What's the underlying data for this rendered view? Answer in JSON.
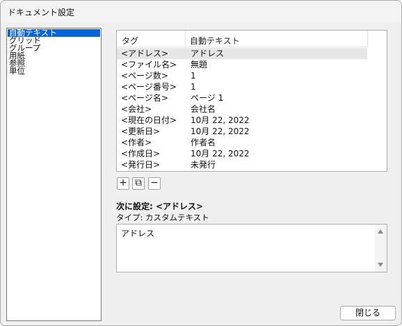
{
  "window": {
    "title": "ドキュメント設定"
  },
  "sidebar": {
    "items": [
      {
        "label": "自動テキスト",
        "selected": true
      },
      {
        "label": "グリッド",
        "selected": false
      },
      {
        "label": "グループ",
        "selected": false
      },
      {
        "label": "用紙",
        "selected": false
      },
      {
        "label": "参照",
        "selected": false
      },
      {
        "label": "単位",
        "selected": false
      }
    ]
  },
  "table": {
    "headers": {
      "tag": "タグ",
      "text": "自動テキスト"
    },
    "rows": [
      {
        "tag": "<アドレス>",
        "text": "アドレス",
        "selected": true
      },
      {
        "tag": "<ファイル名>",
        "text": "無題"
      },
      {
        "tag": "<ページ数>",
        "text": "1"
      },
      {
        "tag": "<ページ番号>",
        "text": "1"
      },
      {
        "tag": "<ページ名>",
        "text": "ページ 1"
      },
      {
        "tag": "<会社>",
        "text": "会社名"
      },
      {
        "tag": "<現在の日付>",
        "text": "10月 22, 2022"
      },
      {
        "tag": "<更新日>",
        "text": "10月 22, 2022"
      },
      {
        "tag": "<作者>",
        "text": "作者名"
      },
      {
        "tag": "<作成日>",
        "text": "10月 22, 2022"
      },
      {
        "tag": "<発行日>",
        "text": "未発行"
      }
    ]
  },
  "toolbar": {
    "add_symbol": "+",
    "duplicate_symbol": "⧉",
    "remove_symbol": "−"
  },
  "detail": {
    "next_label": "次に設定: <アドレス>",
    "type_label": "タイプ: カスタムテキスト",
    "value": "アドレス"
  },
  "buttons": {
    "close_label": "閉じる"
  }
}
